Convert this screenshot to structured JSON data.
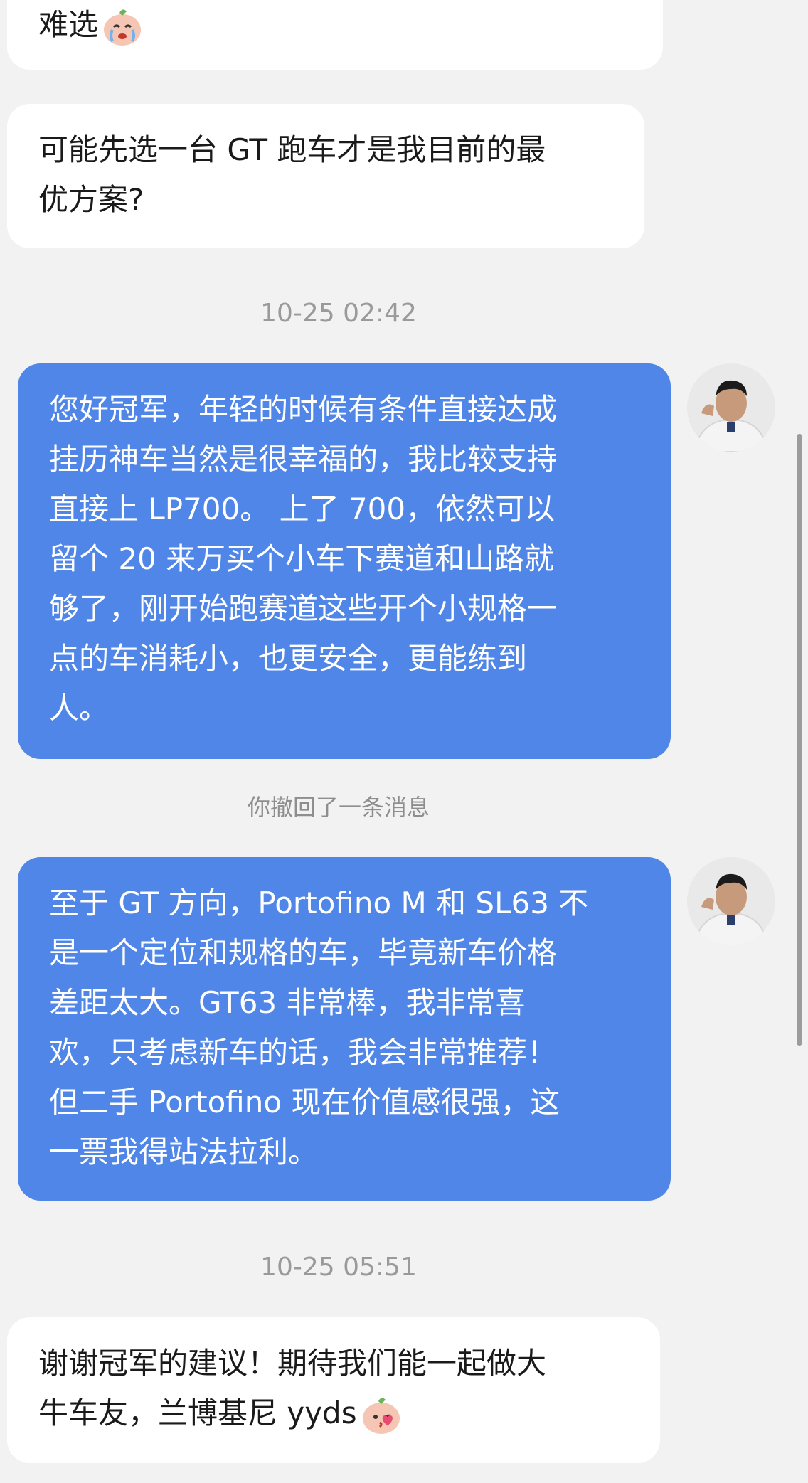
{
  "messages": [
    {
      "type": "received",
      "lines": [
        "难选"
      ],
      "emoji": "crying-peach-emoji-icon"
    },
    {
      "type": "received",
      "lines": [
        "可能先选一台 GT 跑车才是我目前的最",
        "优方案?"
      ]
    },
    {
      "type": "timestamp",
      "text": "10-25 02:42"
    },
    {
      "type": "sent",
      "lines": [
        "您好冠军，年轻的时候有条件直接达成",
        "挂历神车当然是很幸福的，我比较支持",
        "直接上 LP700。 上了 700，依然可以",
        "留个 20 来万买个小车下赛道和山路就",
        "够了，刚开始跑赛道这些开个小规格一",
        "点的车消耗小，也更安全，更能练到",
        "人。"
      ]
    },
    {
      "type": "notice",
      "text": "你撤回了一条消息"
    },
    {
      "type": "sent",
      "lines": [
        "至于 GT 方向，Portofino M 和 SL63 不",
        "是一个定位和规格的车，毕竟新车价格",
        "差距太大。GT63 非常棒，我非常喜",
        "欢，只考虑新车的话，我会非常推荐！",
        "但二手 Portofino 现在价值感很强，这",
        "一票我得站法拉利。"
      ]
    },
    {
      "type": "timestamp",
      "text": "10-25 05:51"
    },
    {
      "type": "received",
      "lines": [
        "谢谢冠军的建议！期待我们能一起做大",
        "牛车友，兰博基尼 yyds"
      ],
      "emoji": "kissing-peach-emoji-icon"
    }
  ],
  "colors": {
    "background": "#f2f2f2",
    "sent_bubble": "#4f86e8",
    "received_bubble": "#ffffff",
    "timestamp_text": "#9a9a9a"
  },
  "avatar": {
    "icon": "user-avatar-icon"
  }
}
